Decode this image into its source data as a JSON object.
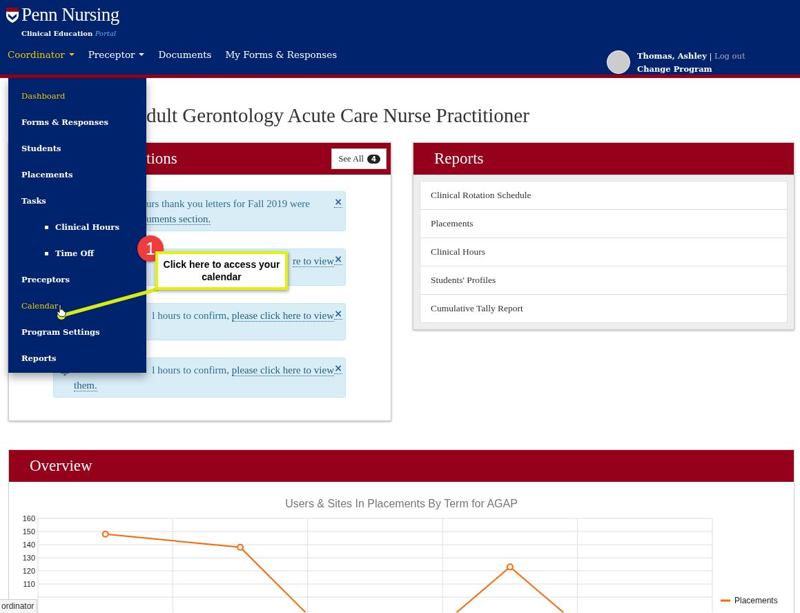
{
  "header": {
    "brand": "Penn Nursing",
    "subtitle": "Clinical Education",
    "subtitle_accent": "Portal",
    "nav": [
      {
        "label": "Coordinator",
        "selected": true,
        "dropdown": true
      },
      {
        "label": "Preceptor",
        "selected": false,
        "dropdown": true
      },
      {
        "label": "Documents",
        "selected": false,
        "dropdown": false
      },
      {
        "label": "My Forms & Responses",
        "selected": false,
        "dropdown": false
      }
    ],
    "user": {
      "name": "Thomas, Ashley",
      "separator": "|",
      "logout": "Log out",
      "change_program": "Change Program"
    }
  },
  "menu": {
    "items": [
      {
        "label": "Dashboard",
        "highlighted": true
      },
      {
        "label": "Forms & Responses",
        "highlighted": false
      },
      {
        "label": "Students",
        "highlighted": false
      },
      {
        "label": "Placements",
        "highlighted": false
      },
      {
        "label": "Tasks",
        "highlighted": false,
        "children": [
          {
            "label": "Clinical Hours",
            "highlighted": false
          },
          {
            "label": "Time Off",
            "highlighted": false
          }
        ]
      },
      {
        "label": "Preceptors",
        "highlighted": false
      },
      {
        "label": "Calendar",
        "highlighted": true
      },
      {
        "label": "Program Settings",
        "highlighted": false
      },
      {
        "label": "Reports",
        "highlighted": false
      }
    ]
  },
  "page_title": "dult Gerontology Acute Care Nurse Practitioner",
  "notifications": {
    "title": "tions",
    "see_all": "See All",
    "count": "4",
    "items": [
      {
        "close": "×",
        "bell": false,
        "lines": [
          {
            "kind": "clipped",
            "segments": [
              {
                "text": "urs thank you letters for Fall 2019 were",
                "link": false
              }
            ]
          },
          {
            "kind": "clipped",
            "segments": [
              {
                "text": "uments section.",
                "link": true
              }
            ]
          }
        ]
      },
      {
        "close": "×",
        "bell": false,
        "lines": [
          {
            "kind": "tail",
            "segments": [
              {
                "text": "re to view",
                "link": true
              }
            ]
          }
        ]
      },
      {
        "close": "×",
        "bell": false,
        "lines": [
          {
            "kind": "tail",
            "segments": [
              {
                "text": "l hours to confirm, ",
                "link": false
              },
              {
                "text": "please click here to view",
                "link": true
              }
            ]
          }
        ]
      },
      {
        "close": "×",
        "bell": true,
        "lines": [
          {
            "kind": "tail",
            "segments": [
              {
                "text": "l hours to confirm, ",
                "link": false
              },
              {
                "text": "please click here to view",
                "link": true
              }
            ]
          },
          {
            "kind": "full",
            "segments": [
              {
                "text": "them.",
                "link": true
              }
            ]
          }
        ]
      }
    ]
  },
  "reports": {
    "title": "Reports",
    "items": [
      "Clinical Rotation Schedule",
      "Placements",
      "Clinical Hours",
      "Students' Profiles",
      "Cumulative Tally Report"
    ]
  },
  "overview": {
    "title": "Overview",
    "chart_data": {
      "type": "line",
      "title": "Users & Sites In Placements By Term for AGAP",
      "grid": true,
      "ylim": [
        88,
        160
      ],
      "yticks": [
        110,
        120,
        130,
        140,
        150,
        160
      ],
      "series": [
        {
          "name": "Placements",
          "color": "#ff6600",
          "marker": "o",
          "values": [
            148,
            138,
            null,
            123,
            null
          ]
        }
      ]
    }
  },
  "callout": {
    "number": "1",
    "text": "Click here to access your calendar"
  },
  "status_bar": "ordinator"
}
